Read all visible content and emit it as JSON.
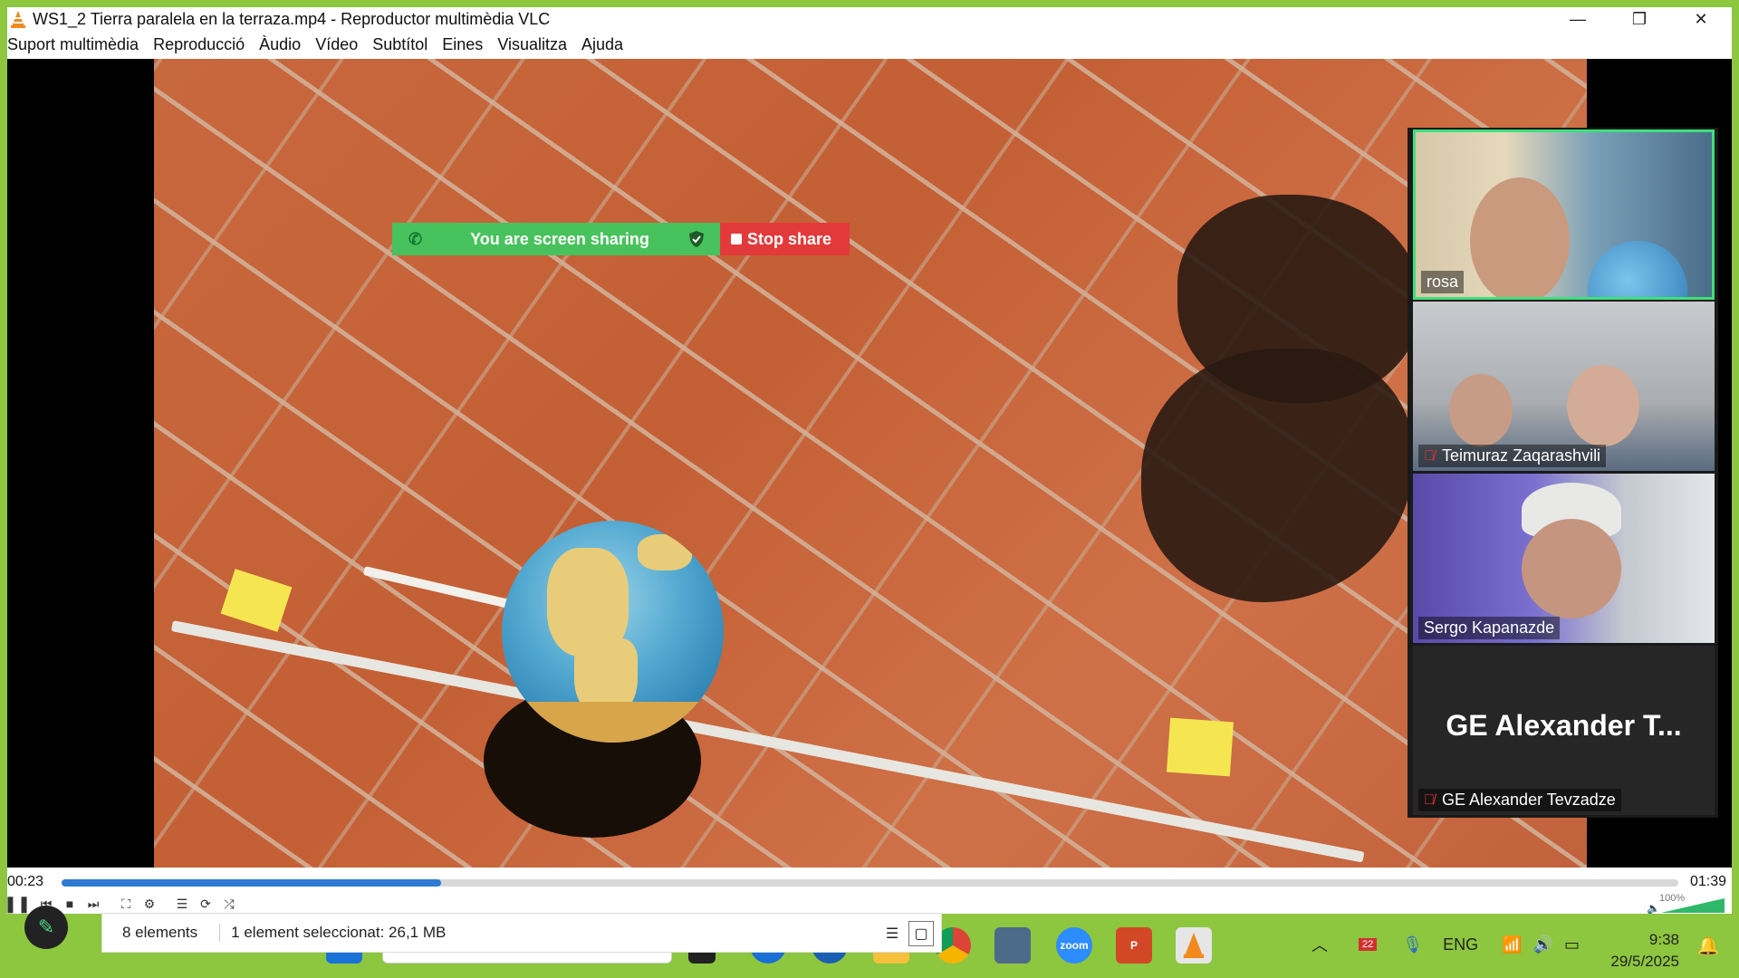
{
  "window": {
    "title": "WS1_2 Tierra paralela en la terraza.mp4 - Reproductor multimèdia VLC",
    "controls": [
      "—",
      "❐",
      "✕"
    ]
  },
  "menu": [
    "Suport multimèdia",
    "Reproducció",
    "Àudio",
    "Vídeo",
    "Subtítol",
    "Eines",
    "Visualitza",
    "Ajuda"
  ],
  "zoom_share_bar": {
    "sharing_text": "You are screen sharing",
    "stop_label": "Stop share"
  },
  "gallery": {
    "participants": [
      {
        "name": "rosa",
        "muted": false,
        "active_speaker": true
      },
      {
        "name": "Teimuraz Zaqarashvili",
        "muted": true
      },
      {
        "name": "Sergo Kapanazde",
        "muted": false
      },
      {
        "name": "GE Alexander Tevzadze",
        "muted": true,
        "display_text": "GE Alexander T..."
      }
    ]
  },
  "player": {
    "elapsed": "00:23",
    "duration": "01:39",
    "progress_fraction": 0.235,
    "volume_label": "100%"
  },
  "explorer": {
    "count": "8 elements",
    "selection": "1 element seleccionat: 26,1 MB"
  },
  "taskbar": {
    "tray": {
      "calendar_badge": "22",
      "language": "ENG",
      "time": "9:38",
      "date": "29/5/2025"
    }
  },
  "colors": {
    "border_green": "#8dc63f",
    "share_green": "#48c25c",
    "stop_red": "#e23a3a",
    "seek_blue": "#2f7ad2",
    "speaker_highlight": "#3ee07b"
  }
}
